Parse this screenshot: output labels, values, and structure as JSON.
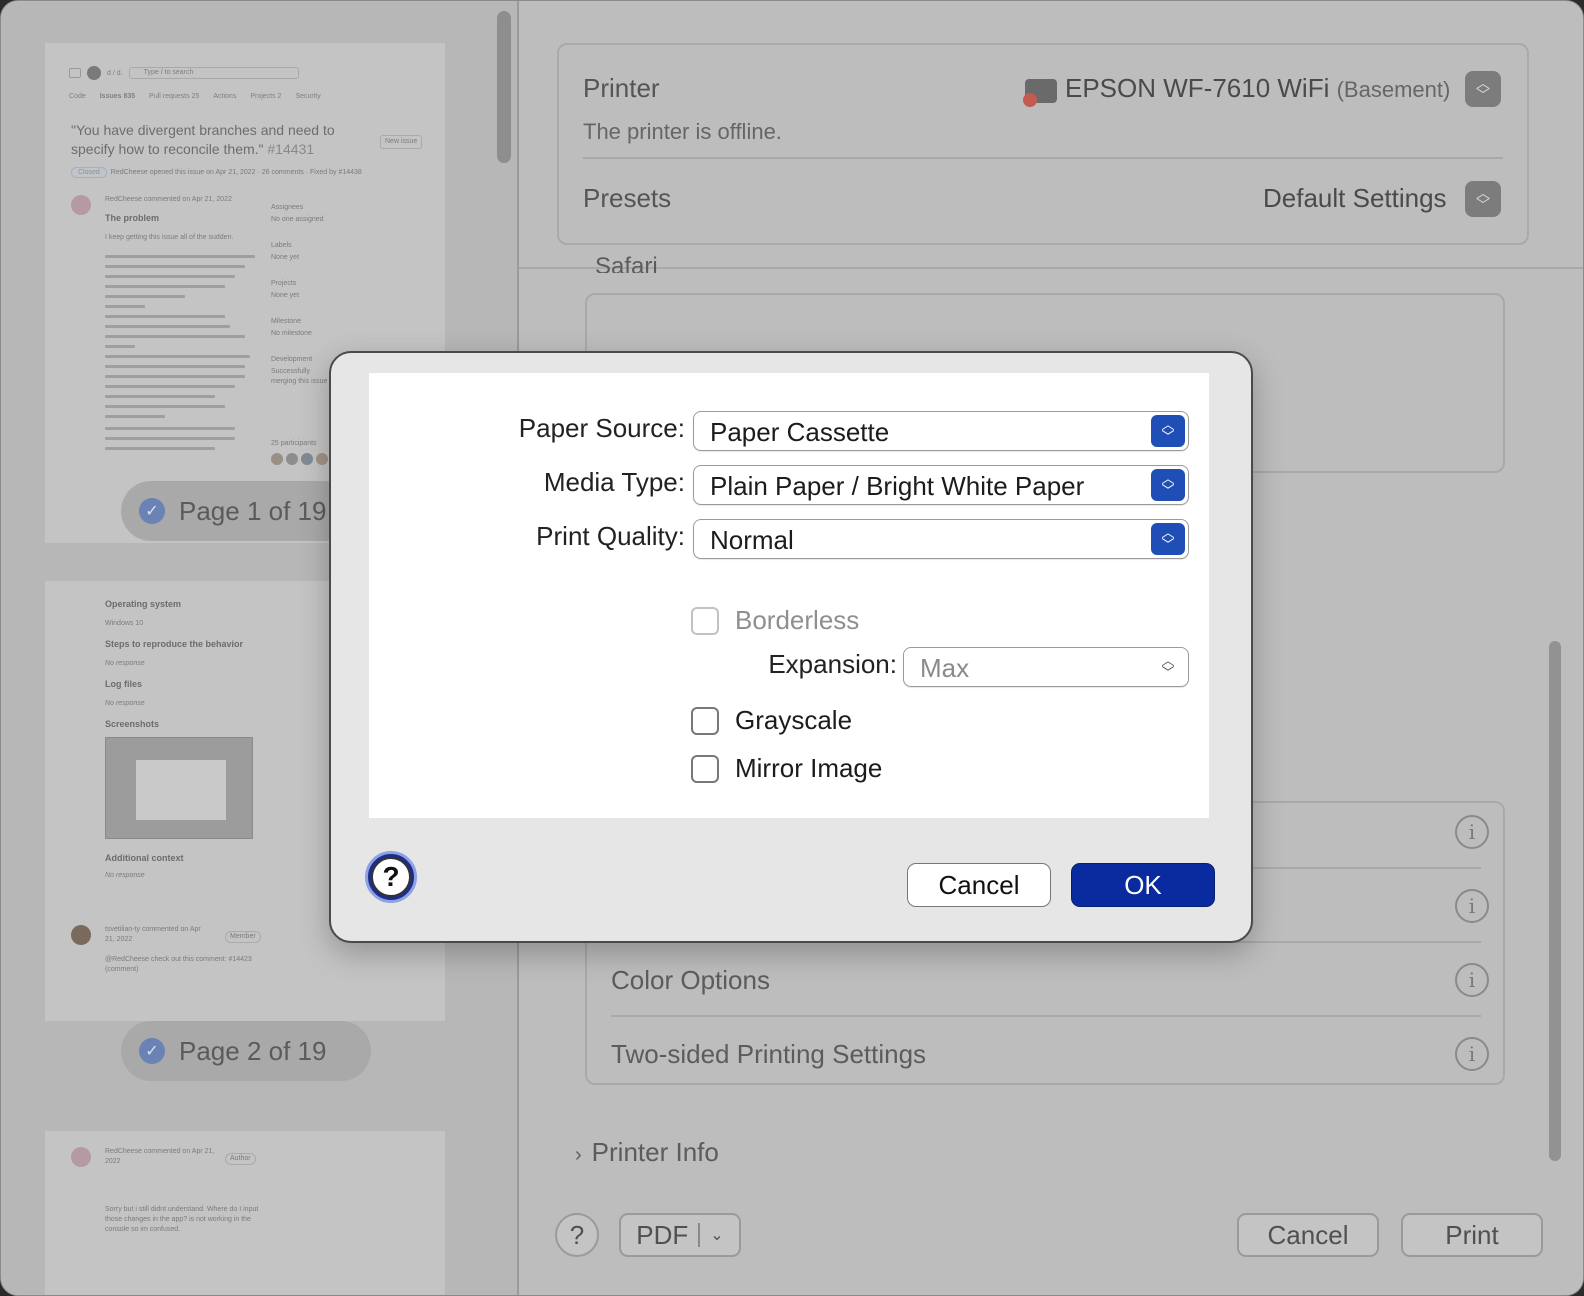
{
  "preview": {
    "gh_search": "Type / to search",
    "gh_repo": "d / d.",
    "tabs": [
      "Code",
      "Issues 835",
      "Pull requests 25",
      "Actions",
      "Projects 2",
      "Security"
    ],
    "issue_title": "\"You have divergent branches and need to specify how to reconcile them.\"",
    "issue_number": "#14431",
    "new_issue": "New issue",
    "status": "Closed",
    "meta": "RedCheese opened this issue on Apr 21, 2022 · 26 comments · Fixed by #14438",
    "author_line": "RedCheese commented on Apr 21, 2022",
    "problem_heading": "The problem",
    "problem_intro": "I keep getting this issue all of the sudden.",
    "sidebar": [
      "Assignees",
      "No one assigned",
      "Labels",
      "None yet",
      "Projects",
      "None yet",
      "Milestone",
      "No milestone",
      "Development",
      "Successfully merging this issue",
      "25 participants"
    ],
    "page1_label": "Page 1 of 19",
    "page2_sections": [
      "Operating system",
      "Windows 10",
      "Steps to reproduce the behavior",
      "No response",
      "Log files",
      "No response",
      "Screenshots",
      "Additional context",
      "No response"
    ],
    "comment2_author": "tsvetilian-ty commented on Apr 21, 2022",
    "comment2_role": "Member",
    "comment2_text": "@RedCheese check out this comment: #14423 (comment)",
    "page2_label": "Page 2 of 19",
    "comment3_author": "RedCheese commented on Apr 21, 2022",
    "comment3_role": "Author",
    "comment3_text": "Sorry but i still didnt understand. Where do I input those changes in the app? is not working in the console so im confused."
  },
  "settings": {
    "printer_label": "Printer",
    "printer_name": "EPSON WF-7610 WiFi",
    "printer_location": "(Basement)",
    "printer_status": "The printer is offline.",
    "presets_label": "Presets",
    "presets_value": "Default Settings",
    "safari_section": "Safari",
    "rows": [
      "Color Options",
      "Two-sided Printing Settings"
    ],
    "printer_info": "Printer Info",
    "pdf_label": "PDF",
    "cancel_label": "Cancel",
    "print_label": "Print",
    "help_label": "?"
  },
  "modal": {
    "paper_source_label": "Paper Source:",
    "paper_source_value": "Paper Cassette",
    "media_type_label": "Media Type:",
    "media_type_value": "Plain Paper / Bright White Paper",
    "print_quality_label": "Print Quality:",
    "print_quality_value": "Normal",
    "borderless_label": "Borderless",
    "borderless_checked": false,
    "borderless_enabled": false,
    "expansion_label": "Expansion:",
    "expansion_value": "Max",
    "grayscale_label": "Grayscale",
    "grayscale_checked": false,
    "mirror_label": "Mirror Image",
    "mirror_checked": false,
    "help_label": "?",
    "cancel_label": "Cancel",
    "ok_label": "OK"
  },
  "colors": {
    "accent": "#1f4fb6",
    "ok_button": "#0a2a9f",
    "offline_dot": "#d23b2b"
  }
}
